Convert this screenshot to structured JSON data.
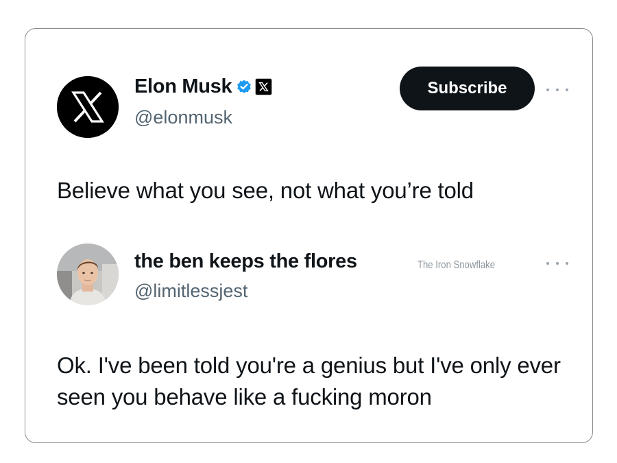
{
  "tweet": {
    "display_name": "Elon Musk",
    "handle": "@elonmusk",
    "subscribe_label": "Subscribe",
    "text": "Believe what you see, not what you’re told",
    "avatar_icon": "x-logo-icon",
    "verified_icon": "verified-badge-icon",
    "affiliation_icon": "x-affiliation-icon",
    "more_icon": "more-options-icon"
  },
  "reply": {
    "display_name": "the ben keeps the flores",
    "handle": "@limitlessjest",
    "text": "Ok. I've been told you're a genius but I've only ever seen you behave like a fucking moron",
    "avatar": "profile-photo",
    "more_icon": "more-options-icon"
  },
  "watermark": "The Iron Snowflake",
  "colors": {
    "verified_blue": "#1d9bf0",
    "button_bg": "#0f1419",
    "handle_gray": "#536471"
  }
}
